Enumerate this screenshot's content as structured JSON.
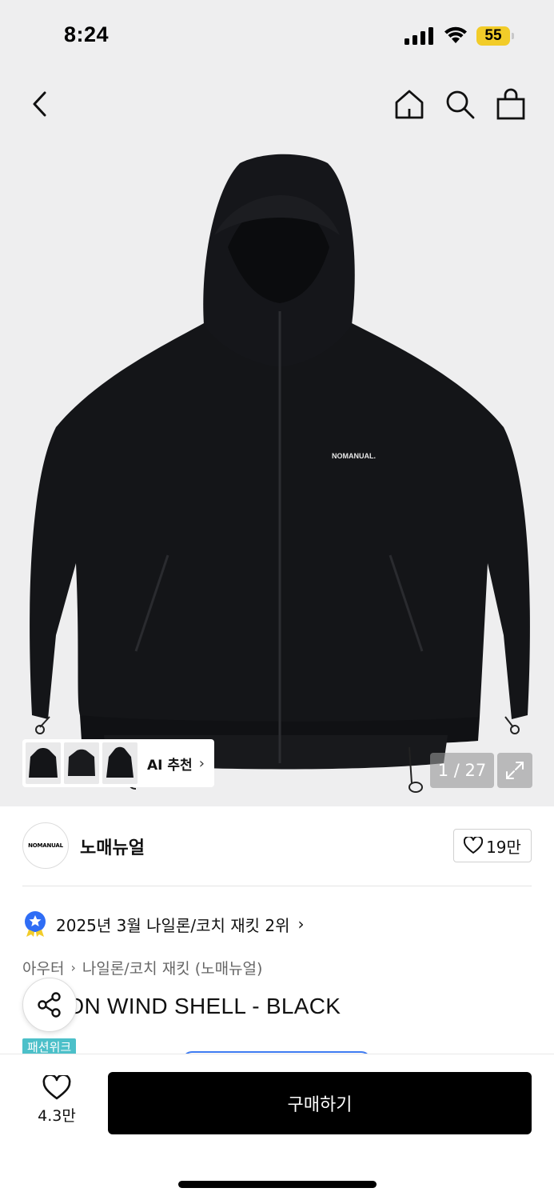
{
  "status_bar": {
    "time": "8:24",
    "battery": "55"
  },
  "nav": {
    "back_icon": "chevron-left-icon",
    "home_icon": "home-icon",
    "search_icon": "search-icon",
    "cart_icon": "shopping-bag-icon"
  },
  "product_image": {
    "print_text": "NOMANUAL.",
    "ai_label": "AI 추천",
    "counter": "1 / 27"
  },
  "brand": {
    "logo_text": "NOMANUAL",
    "name": "노매뉴얼",
    "like_count": "19만"
  },
  "ranking": {
    "text": "2025년 3월 나일론/코치 재킷 2위"
  },
  "breadcrumb": {
    "items": [
      "아우터",
      "나일론/코치 재킷 (노매뉴얼)"
    ]
  },
  "product": {
    "title": "NYLON WIND SHELL - BLACK",
    "badge": "패션위크"
  },
  "bottom_bar": {
    "wish_count": "4.3만",
    "buy_label": "구매하기"
  },
  "colors": {
    "background": "#eeeeef",
    "buy_button": "#000000",
    "badge": "#4cc0c9",
    "battery": "#f2cc29",
    "ranking_icon": "#2f6df5"
  }
}
